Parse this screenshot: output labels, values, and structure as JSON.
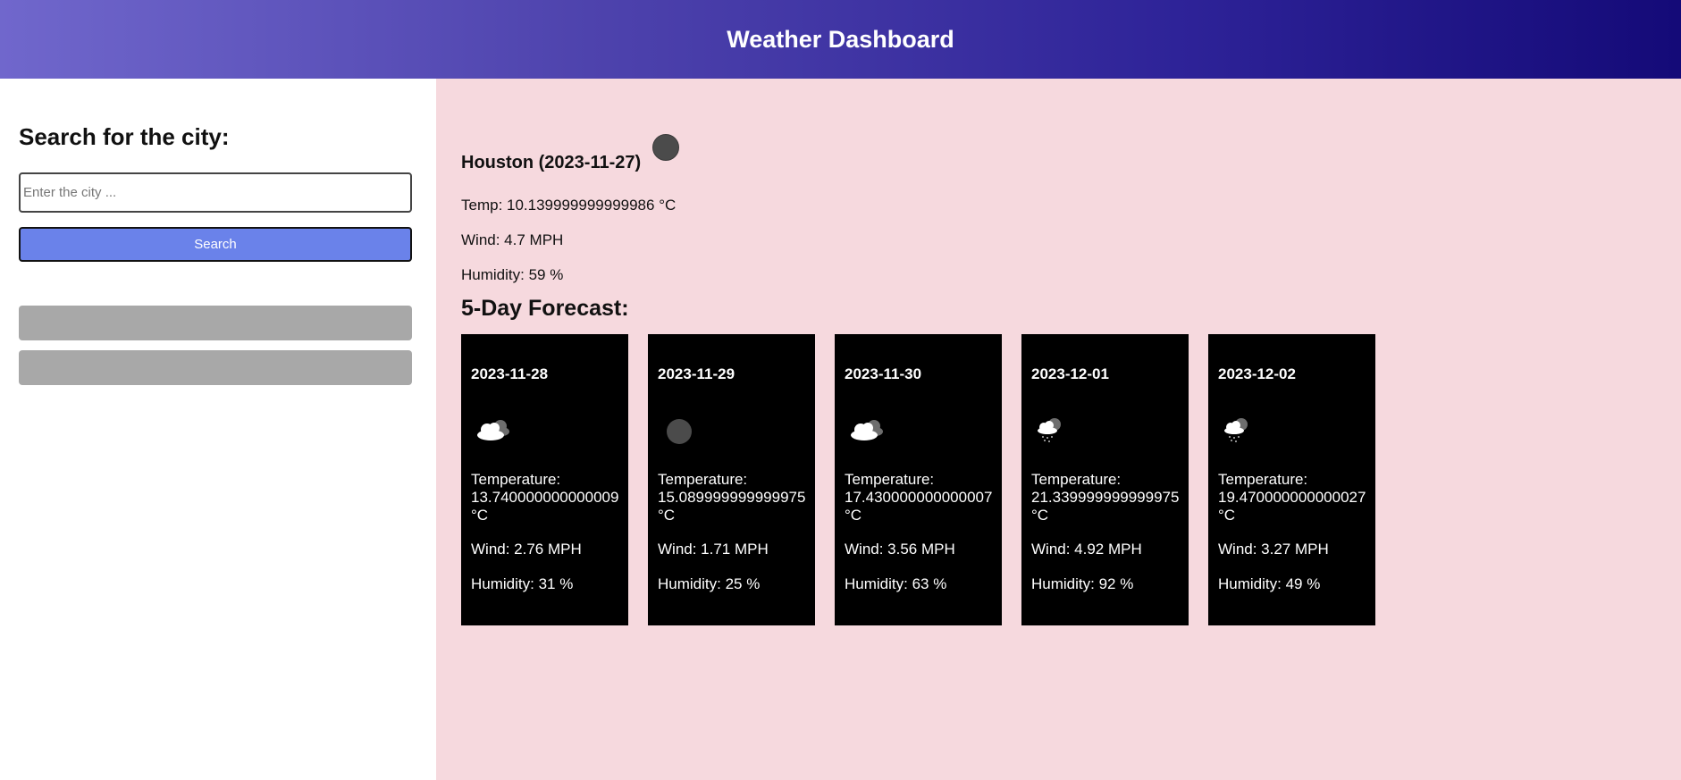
{
  "header": {
    "title": "Weather Dashboard"
  },
  "sidebar": {
    "heading": "Search for the city:",
    "search": {
      "placeholder": "Enter the city ...",
      "value": ""
    },
    "search_button_label": "Search",
    "history": [
      {
        "label": ""
      },
      {
        "label": ""
      }
    ]
  },
  "current": {
    "title": "Houston (2023-11-27)",
    "icon": "dark-circle-icon",
    "temp": "Temp: 10.139999999999986 °C",
    "wind": "Wind: 4.7 MPH",
    "humidity": "Humidity: 59 %"
  },
  "forecast": {
    "heading": "5-Day Forecast:",
    "days": [
      {
        "date": "2023-11-28",
        "icon": "broken-clouds-icon",
        "temp_label": "Temperature:",
        "temp_value": "13.740000000000009",
        "temp_unit": "°C",
        "wind": "Wind: 2.76 MPH",
        "humidity": "Humidity: 31 %"
      },
      {
        "date": "2023-11-29",
        "icon": "dark-circle-icon",
        "temp_label": "Temperature:",
        "temp_value": "15.089999999999975",
        "temp_unit": "°C",
        "wind": "Wind: 1.71 MPH",
        "humidity": "Humidity: 25 %"
      },
      {
        "date": "2023-11-30",
        "icon": "broken-clouds-icon",
        "temp_label": "Temperature:",
        "temp_value": "17.430000000000007",
        "temp_unit": "°C",
        "wind": "Wind: 3.56 MPH",
        "humidity": "Humidity: 63 %"
      },
      {
        "date": "2023-12-01",
        "icon": "light-rain-icon",
        "temp_label": "Temperature:",
        "temp_value": "21.339999999999975",
        "temp_unit": "°C",
        "wind": "Wind: 4.92 MPH",
        "humidity": "Humidity: 92 %"
      },
      {
        "date": "2023-12-02",
        "icon": "light-rain-icon",
        "temp_label": "Temperature:",
        "temp_value": "19.470000000000027",
        "temp_unit": "°C",
        "wind": "Wind: 3.27 MPH",
        "humidity": "Humidity: 49 %"
      }
    ]
  },
  "colors": {
    "header_gradient_start": "#7067cc",
    "header_gradient_end": "#140a78",
    "search_button": "#6a82ea",
    "history_button": "#a8a8a8",
    "main_background": "#f6d9de",
    "card_background": "#000000"
  }
}
